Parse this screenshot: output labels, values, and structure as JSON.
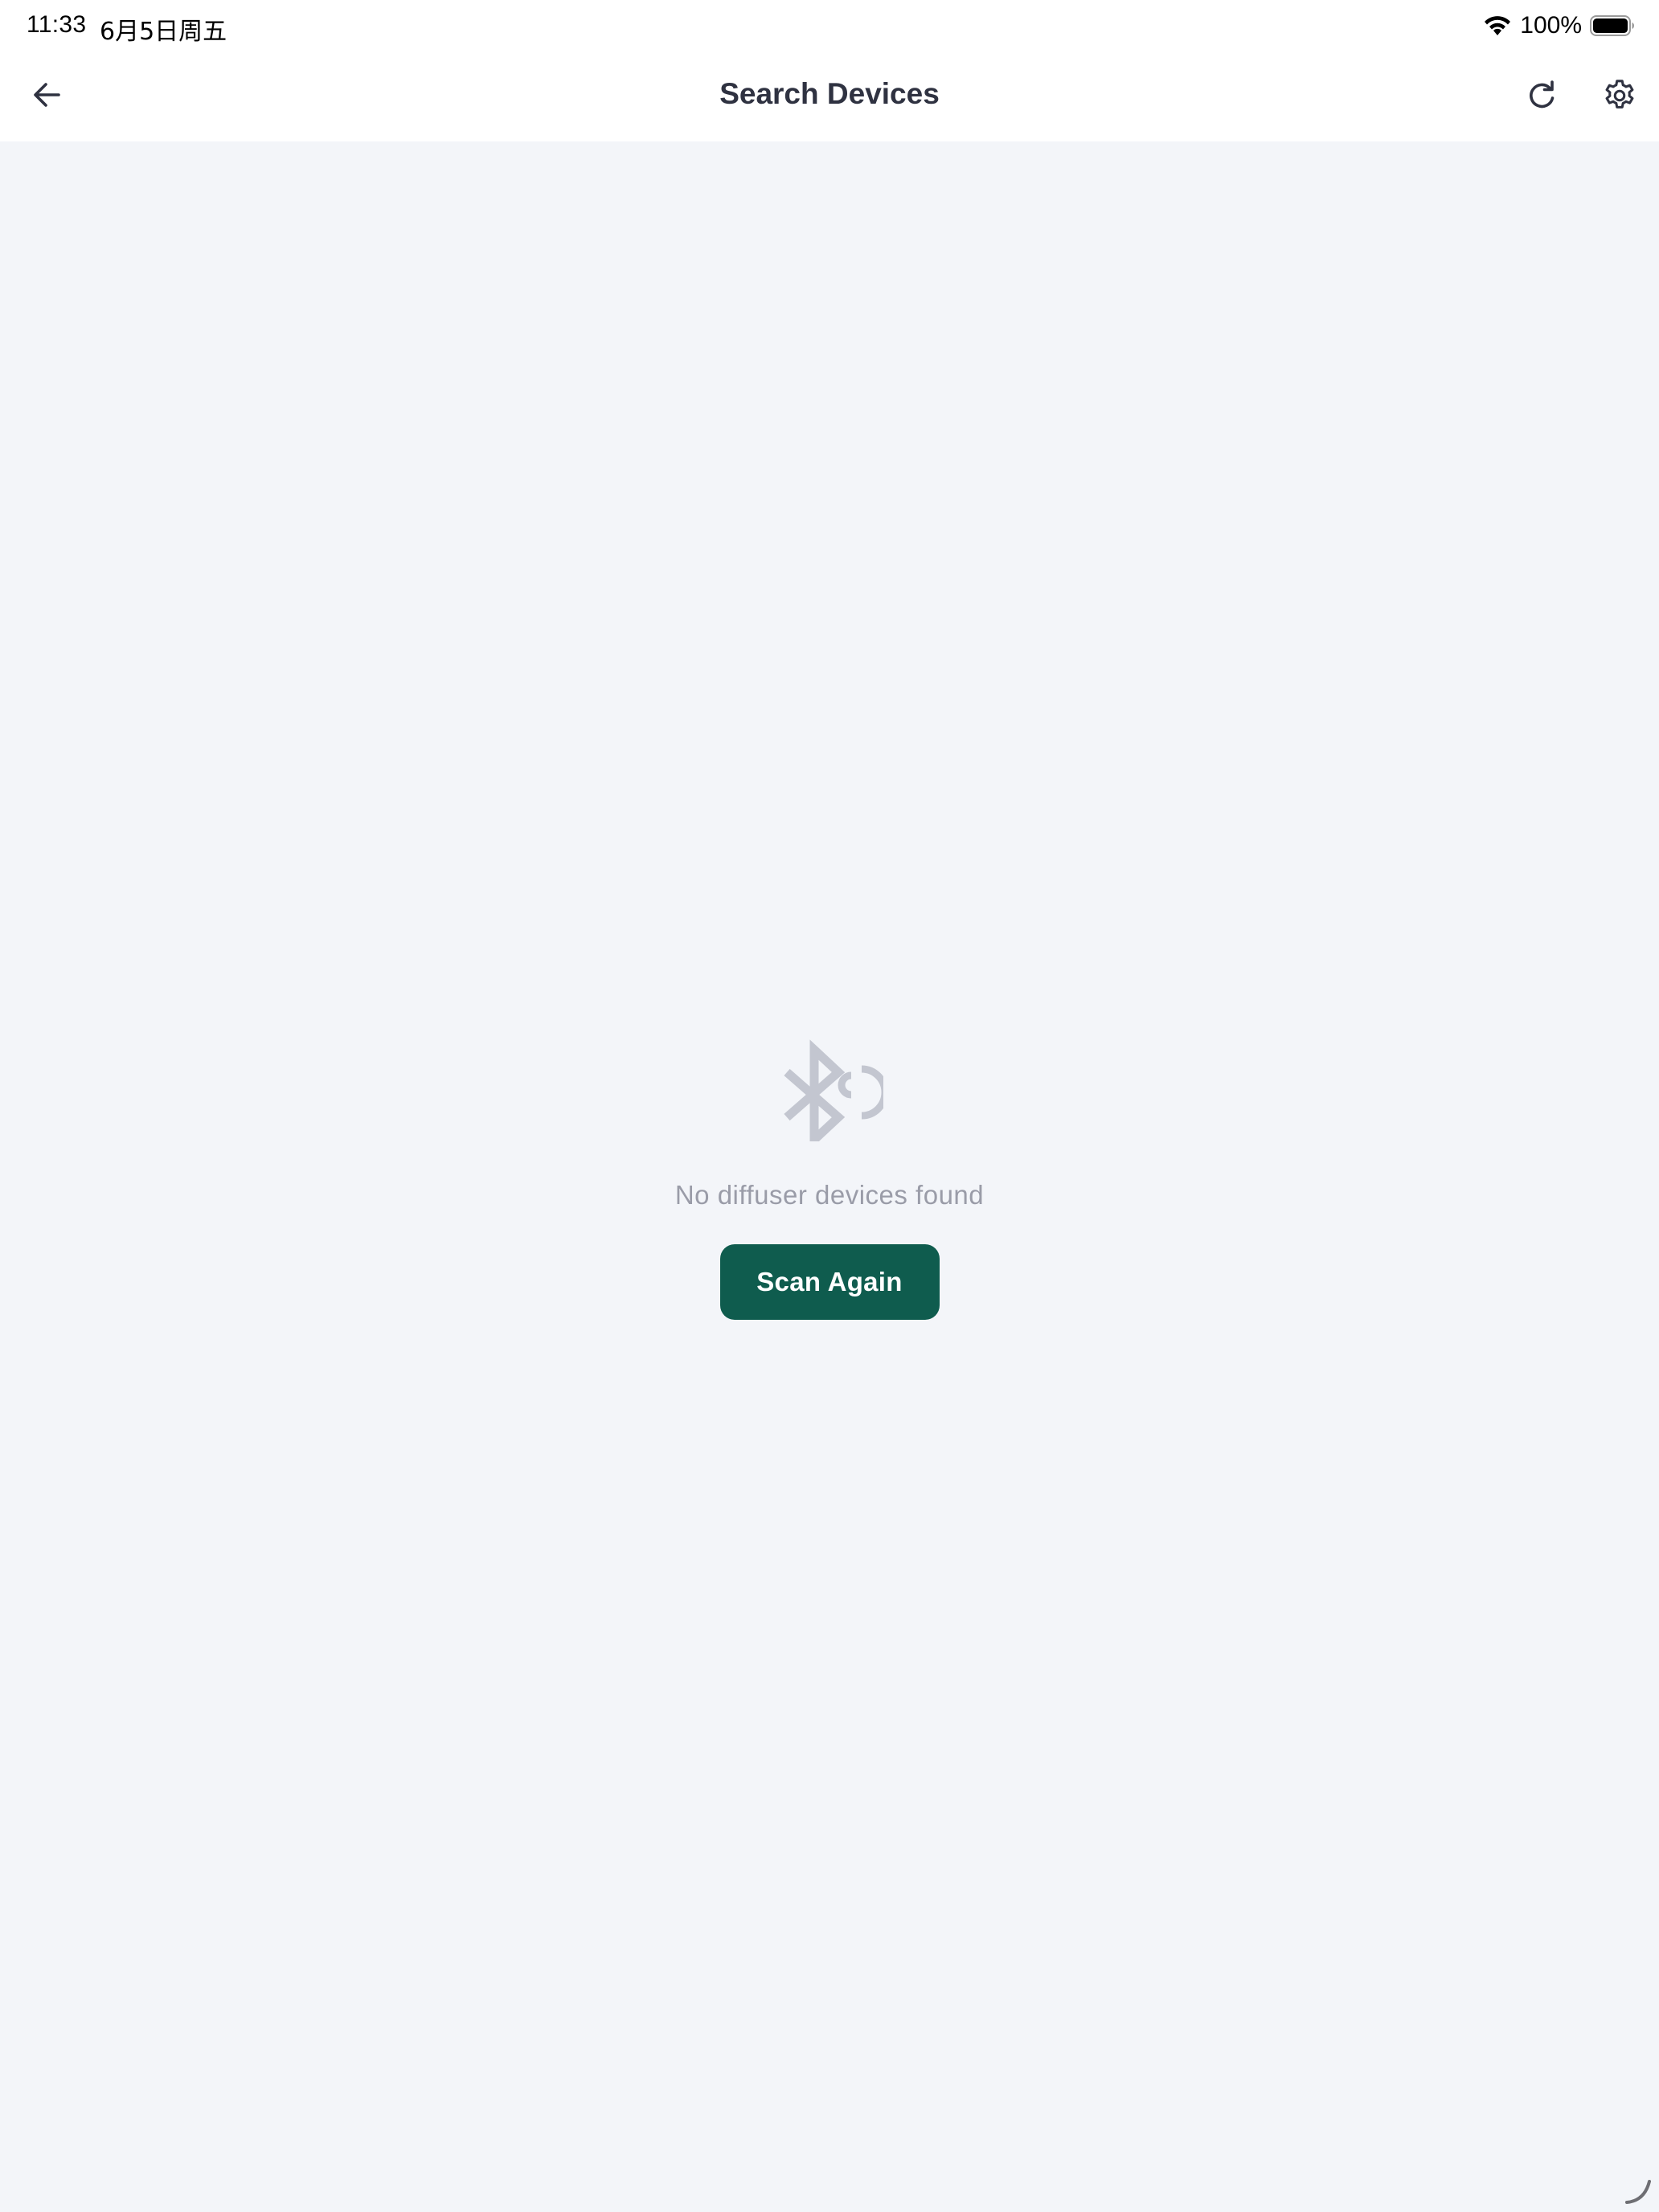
{
  "status_bar": {
    "time": "11:33",
    "date": "6月5日周五",
    "battery_percent": "100%",
    "battery_level": 1.0
  },
  "header": {
    "title": "Search Devices",
    "icons": [
      "back-arrow-icon",
      "refresh-icon",
      "settings-gear-icon"
    ]
  },
  "empty_state": {
    "icon": "bluetooth-searching-icon",
    "message": "No diffuser devices found",
    "button_label": "Scan Again"
  },
  "colors": {
    "background": "#f3f5f9",
    "header_background": "#ffffff",
    "title_text": "#2f3241",
    "primary_button": "#0f5c4e",
    "muted_text": "#9a9ca8",
    "muted_icon": "#c3c6d0"
  }
}
